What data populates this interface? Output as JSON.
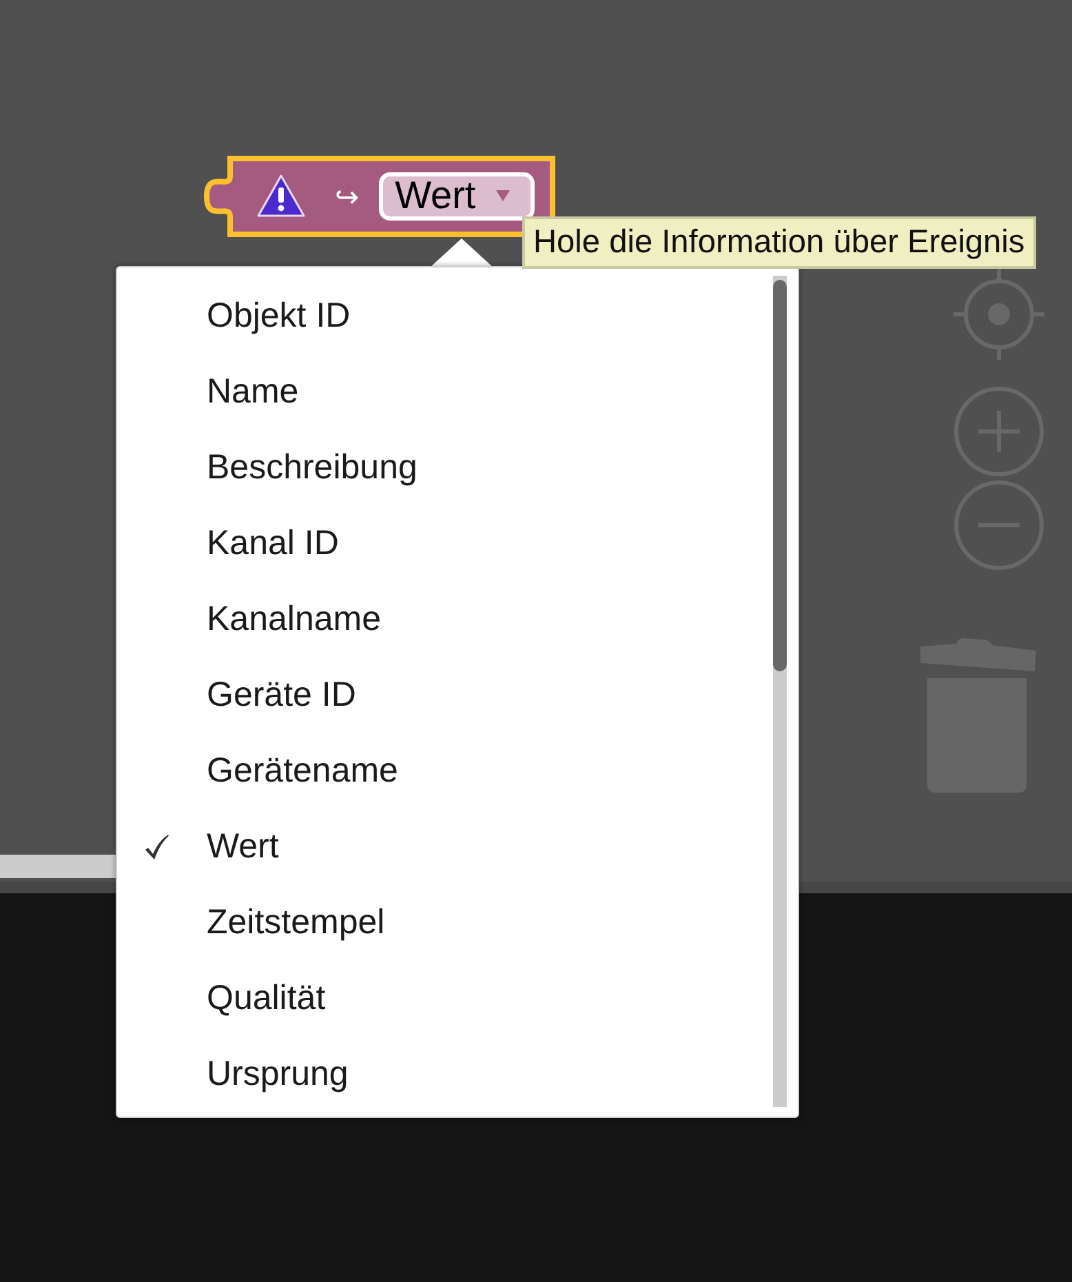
{
  "block": {
    "selected": true,
    "arrow": "↪",
    "field": {
      "value": "Wert"
    }
  },
  "tooltip": {
    "text": "Hole die Information über Ereignis"
  },
  "dropdown_menu": {
    "items": [
      {
        "label": "Objekt ID",
        "selected": false
      },
      {
        "label": "Name",
        "selected": false
      },
      {
        "label": "Beschreibung",
        "selected": false
      },
      {
        "label": "Kanal ID",
        "selected": false
      },
      {
        "label": "Kanalname",
        "selected": false
      },
      {
        "label": "Geräte ID",
        "selected": false
      },
      {
        "label": "Gerätename",
        "selected": false
      },
      {
        "label": "Wert",
        "selected": true
      },
      {
        "label": "Zeitstempel",
        "selected": false
      },
      {
        "label": "Qualität",
        "selected": false
      },
      {
        "label": "Ursprung",
        "selected": false
      }
    ]
  }
}
